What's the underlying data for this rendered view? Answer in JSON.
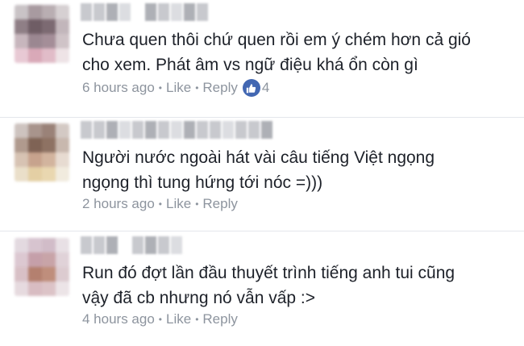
{
  "comments": [
    {
      "text_line1": "Chưa quen thôi chứ quen rồi em ý chém hơn cả gió",
      "text_line2": "cho xem. Phát âm vs ngữ điệu khá ổn còn gì",
      "time": "6 hours ago",
      "like_label": "Like",
      "reply_label": "Reply",
      "reaction_icon": "thumbs-up-icon",
      "reaction_count": "4"
    },
    {
      "text_line1": "Người nước ngoài hát vài câu tiếng Việt ngọng",
      "text_line2": "ngọng thì tung hứng tới nóc =)))",
      "time": "2 hours ago",
      "like_label": "Like",
      "reply_label": "Reply"
    },
    {
      "text_line1": "Run đó đợt lần đầu thuyết trình tiếng anh tui cũng",
      "text_line2": "vậy đã cb nhưng nó vẫn vấp :>",
      "time": "4 hours ago",
      "like_label": "Like",
      "reply_label": "Reply"
    }
  ],
  "colors": {
    "text": "#1d2129",
    "meta": "#8d949e",
    "like_blue": "#4267b2",
    "divider": "#e4e6eb"
  }
}
